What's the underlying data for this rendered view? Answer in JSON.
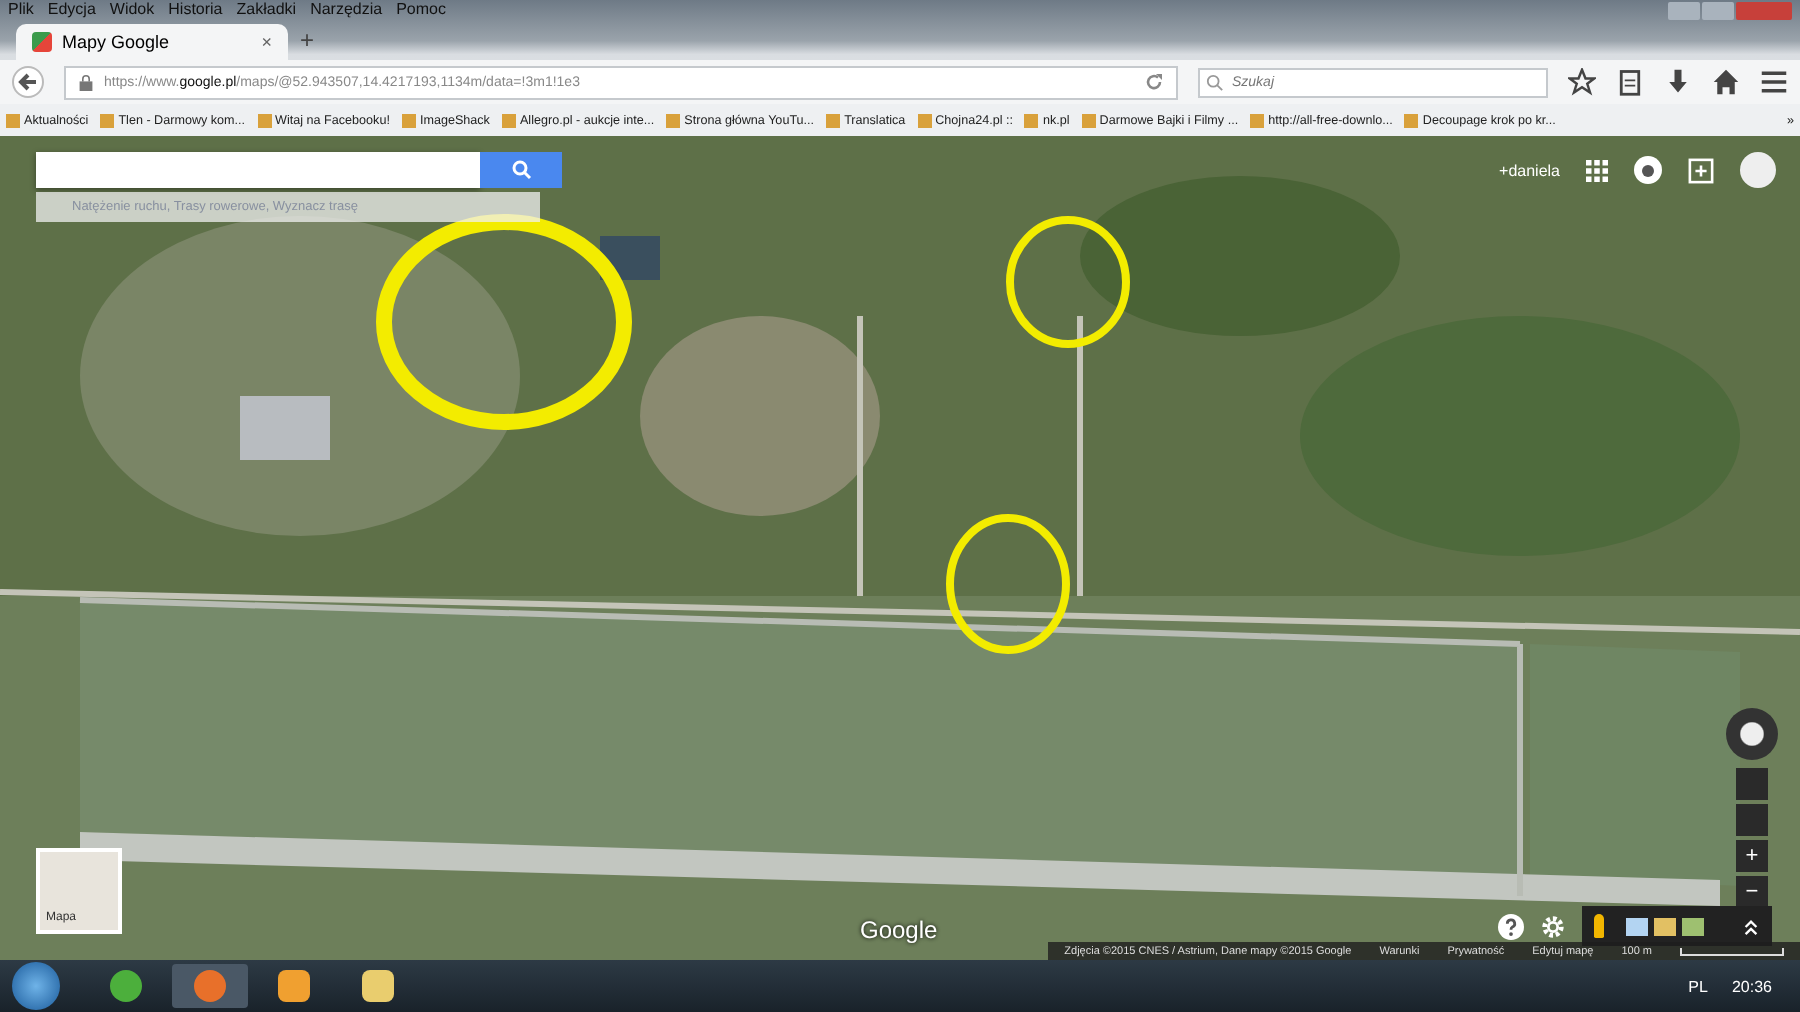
{
  "menu_bar": [
    "Plik",
    "Edycja",
    "Widok",
    "Historia",
    "Zakładki",
    "Narzędzia",
    "Pomoc"
  ],
  "tabs": [
    {
      "label": "Mapy Google",
      "selected": true
    }
  ],
  "tab_close": "×",
  "new_tab": "+",
  "address_bar": {
    "prefix": "https://www.",
    "domain": "google.pl",
    "path": "/maps/@52.943507,14.4217193,1134m/data=!3m1!1e3"
  },
  "search_field": {
    "placeholder": "Szukaj"
  },
  "bookmarks": [
    "Aktualności",
    "Tlen - Darmowy kom...",
    "Witaj na Facebooku!",
    "ImageShack",
    "Allegro.pl - aukcje inte...",
    "Strona główna YouTu...",
    "Translatica",
    "Chojna24.pl ::",
    "nk.pl",
    "Darmowe Bajki i Filmy ...",
    "http://all-free-downlo...",
    "Decoupage krok po kr..."
  ],
  "bookmarks_more": "»",
  "map": {
    "hint": "Natężenie ruchu, Trasy rowerowe, Wyznacz trasę",
    "user": "+daniela",
    "logo": "Google",
    "map_toggle": "Mapa",
    "zoom_in": "+",
    "zoom_out": "−",
    "footer": [
      "Zdjęcia ©2015 CNES / Astrium, Dane mapy ©2015 Google",
      "Warunki",
      "Prywatność",
      "Edytuj mapę"
    ],
    "scale": "100 m"
  },
  "taskbar": {
    "language": "PL",
    "time": "20:36"
  }
}
